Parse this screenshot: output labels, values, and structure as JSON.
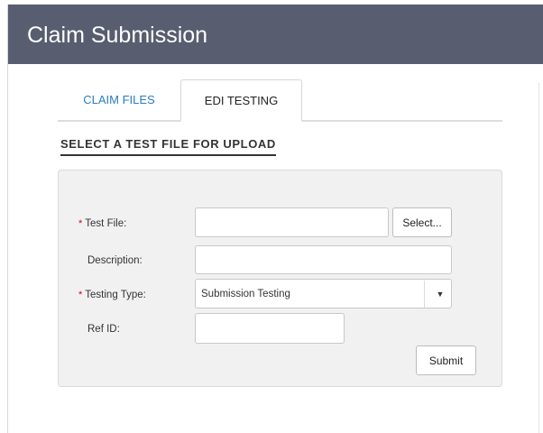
{
  "header": {
    "title": "Claim Submission"
  },
  "tabs": [
    {
      "label": "CLAIM FILES",
      "active": false
    },
    {
      "label": "EDI TESTING",
      "active": true
    }
  ],
  "section": {
    "title": "SELECT A TEST FILE FOR UPLOAD"
  },
  "form": {
    "required_marker": "*",
    "test_file": {
      "label": "Test File:",
      "value": "",
      "required": true,
      "select_button": "Select..."
    },
    "description": {
      "label": "Description:",
      "value": ""
    },
    "testing_type": {
      "label": "Testing Type:",
      "value": "Submission Testing",
      "required": true,
      "caret": "▼"
    },
    "ref_id": {
      "label": "Ref ID:",
      "value": ""
    },
    "submit_label": "Submit"
  },
  "colors": {
    "header_bg": "#585d70",
    "tab_active_text": "#222222",
    "tab_inactive_text": "#2b7cc1",
    "required": "#d0021b",
    "form_bg": "#f1f1f1"
  }
}
